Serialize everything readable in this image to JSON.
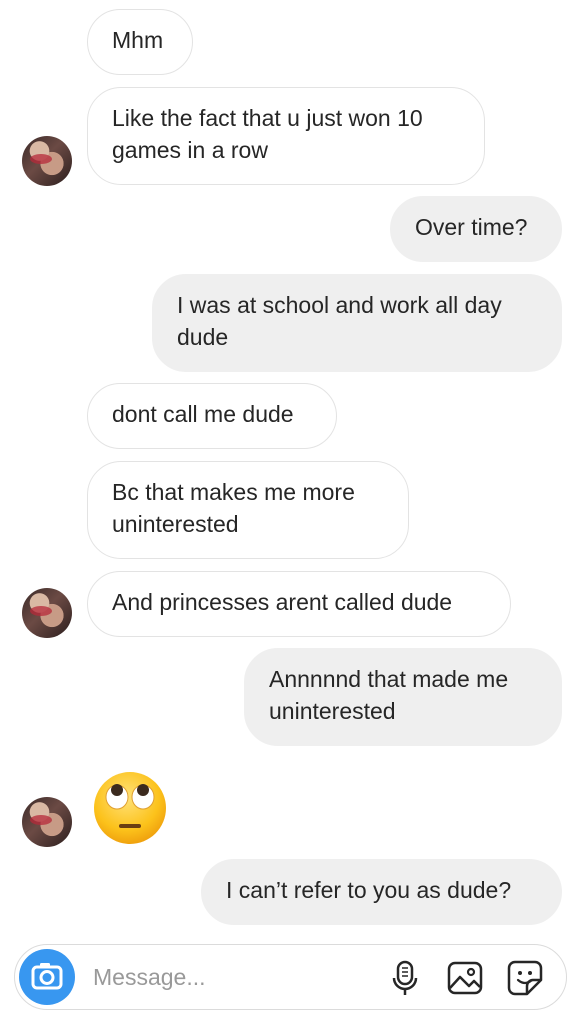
{
  "messages": [
    {
      "text": "Mhm",
      "from": "them"
    },
    {
      "text": "Like the fact that u just won 10\ngames in a row",
      "from": "them"
    },
    {
      "text": "Over time?",
      "from": "me"
    },
    {
      "text": "I was at school and work all day\ndude",
      "from": "me"
    },
    {
      "text": "dont call me dude",
      "from": "them"
    },
    {
      "text": "Bc that makes me more\nuninterested",
      "from": "them"
    },
    {
      "text": "And princesses arent called dude",
      "from": "them"
    },
    {
      "text": "Annnnnd that made me\nuninterested",
      "from": "me"
    },
    {
      "text": "I can’t refer to you as dude?",
      "from": "me"
    }
  ],
  "emoji_message": {
    "icon": "face-with-rolling-eyes-emoji"
  },
  "composer": {
    "placeholder": "Message...",
    "icons": [
      "camera-icon",
      "microphone-icon",
      "gallery-icon",
      "sticker-icon"
    ]
  },
  "colors": {
    "accent": "#3897f0",
    "outgoing_bubble": "#efefef",
    "incoming_border": "#e3e3e3",
    "text": "#262626",
    "placeholder": "#999999"
  }
}
